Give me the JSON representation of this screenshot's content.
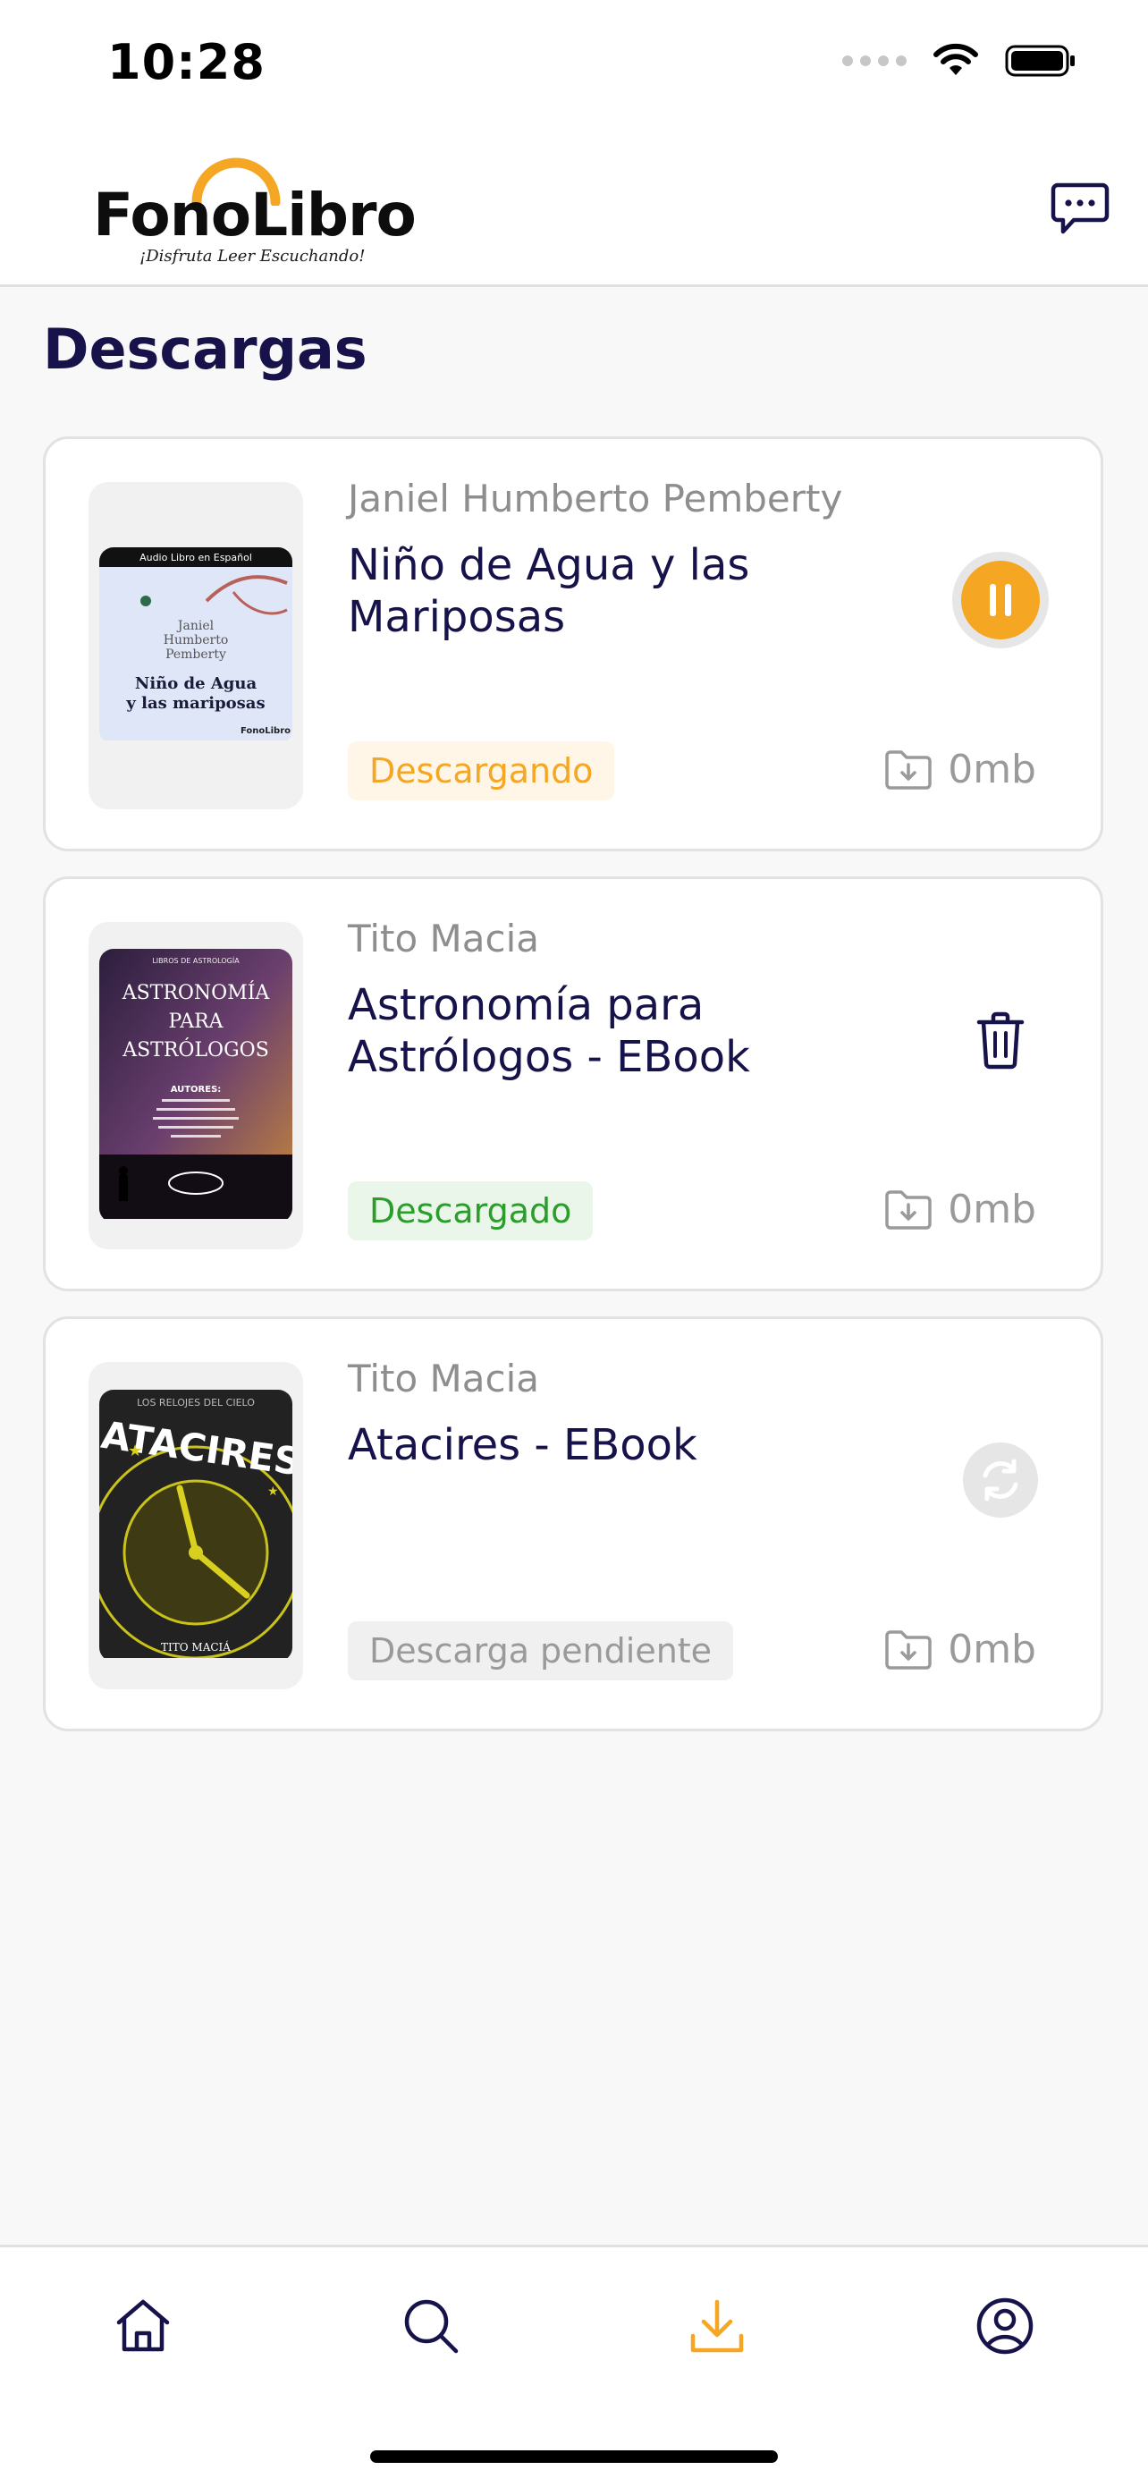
{
  "status_bar": {
    "time": "10:28"
  },
  "header": {
    "logo_text": "FonoLibro",
    "logo_tagline": "¡Disfruta Leer Escuchando!"
  },
  "page": {
    "title": "Descargas"
  },
  "colors": {
    "accent": "#F5A623",
    "navy": "#16134B",
    "success": "#2A9D2A",
    "muted": "#9A9A9A"
  },
  "downloads": [
    {
      "author": "Janiel Humberto Pemberty",
      "title": "Niño de Agua y las Mariposas",
      "status": "Descargando",
      "size": "0mb",
      "action_icon": "pause-icon",
      "cover": {
        "top_label": "Audio Libro en Español",
        "author": "Janiel Humberto Pemberty",
        "title": "Niño de Agua y las mariposas",
        "logo": "FonoLibro"
      }
    },
    {
      "author": "Tito Macia",
      "title": "Astronomía para Astrólogos - EBook",
      "status": "Descargado",
      "size": "0mb",
      "action_icon": "trash-icon",
      "cover": {
        "series": "LIBROS DE ASTROLOGÍA",
        "title_line1": "ASTRONOMÍA",
        "title_line2": "PARA",
        "title_line3": "ASTRÓLOGOS",
        "authors_label": "AUTORES:"
      }
    },
    {
      "author": "Tito Macia",
      "title": "Atacires - EBook",
      "status": "Descarga pendiente",
      "size": "0mb",
      "action_icon": "refresh-icon",
      "cover": {
        "series": "LOS RELOJES DEL CIELO",
        "title": "ATACIRES",
        "author": "TITO MACIÁ"
      }
    }
  ],
  "tab_bar": {
    "active_tab": "downloads",
    "tabs": [
      "home-icon",
      "search-icon",
      "download-icon",
      "profile-icon"
    ]
  }
}
